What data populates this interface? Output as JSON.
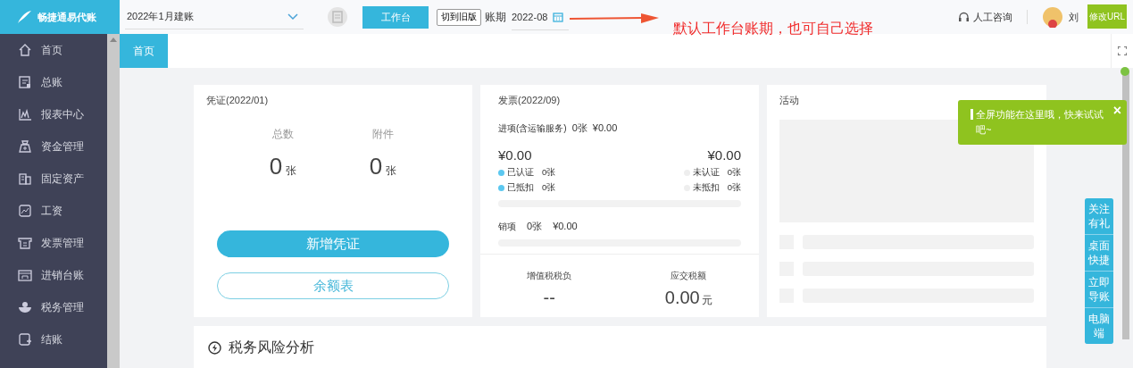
{
  "logo": {
    "title": "畅捷通易代账"
  },
  "header": {
    "account_select": "2022年1月建账",
    "workbench_button": "工作台",
    "old_version_button": "切到旧版",
    "period_label": "账期",
    "period_value": "2022-08",
    "support_link": "人工咨询",
    "user_name": "刘",
    "edit_url_button": "修改URL"
  },
  "annotation": {
    "text": "默认工作台账期，也可自己选择"
  },
  "sidebar": {
    "items": [
      {
        "label": "首页"
      },
      {
        "label": "总账"
      },
      {
        "label": "报表中心"
      },
      {
        "label": "资金管理"
      },
      {
        "label": "固定资产"
      },
      {
        "label": "工资"
      },
      {
        "label": "发票管理"
      },
      {
        "label": "进销台账"
      },
      {
        "label": "税务管理"
      },
      {
        "label": "结账"
      }
    ]
  },
  "tabs": [
    {
      "label": "首页",
      "selected": true
    }
  ],
  "voucher_card": {
    "title": "凭证(2022/01)",
    "stats": [
      {
        "label": "总数",
        "value": "0",
        "unit": "张"
      },
      {
        "label": "附件",
        "value": "0",
        "unit": "张"
      }
    ],
    "buttons": [
      {
        "label": "新增凭证",
        "kind": "primary"
      },
      {
        "label": "余额表",
        "kind": "outline"
      }
    ]
  },
  "invoice_card": {
    "title": "发票(2022/09)",
    "input_line": [
      "进项(含运输服务)",
      "0张",
      "¥0.00"
    ],
    "amounts": [
      "¥0.00",
      "¥0.00"
    ],
    "legend": [
      {
        "label": "已认证",
        "count": "0张",
        "color": "#5cc8f0"
      },
      {
        "label": "未认证",
        "count": "0张",
        "color": "#eeeeee"
      },
      {
        "label": "已抵扣",
        "count": "0张",
        "color": "#5cc8f0"
      },
      {
        "label": "未抵扣",
        "count": "0张",
        "color": "#eeeeee"
      }
    ],
    "output_line": [
      "销项",
      "0张",
      "¥0.00"
    ],
    "tax_stats": [
      {
        "label": "增值税税负",
        "value": "--"
      },
      {
        "label": "应交税额",
        "value": "0.00",
        "unit": "元"
      }
    ]
  },
  "activity_card": {
    "title": "活动"
  },
  "risk_card": {
    "title": "税务风险分析"
  },
  "tooltip": {
    "text": "全屏功能在这里哦，快来试试吧~",
    "close": "×"
  },
  "side_buttons": [
    "关注有礼",
    "桌面快捷",
    "立即导账",
    "电脑端"
  ]
}
